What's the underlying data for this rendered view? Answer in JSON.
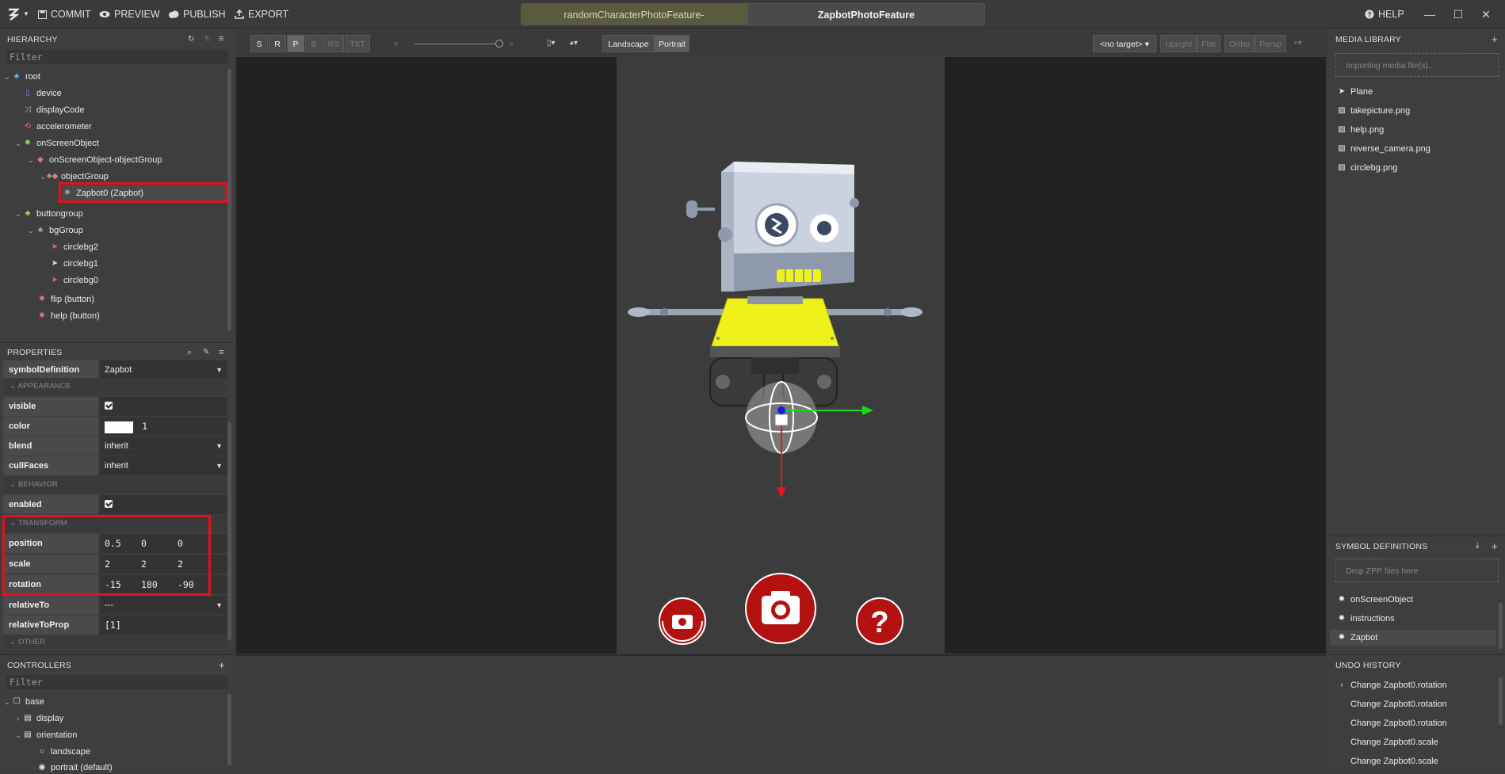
{
  "topbar": {
    "commit": "COMMIT",
    "preview": "PREVIEW",
    "publish": "PUBLISH",
    "export": "EXPORT",
    "tab_a": "randomCharacterPhotoFeature-",
    "tab_b": "ZapbotPhotoFeature",
    "help": "HELP"
  },
  "hierarchy": {
    "title": "HIERARCHY",
    "filter_placeholder": "Filter",
    "items": [
      {
        "label": "root"
      },
      {
        "label": "device"
      },
      {
        "label": "displayCode"
      },
      {
        "label": "accelerometer"
      },
      {
        "label": "onScreenObject"
      },
      {
        "label": "onScreenObject-objectGroup"
      },
      {
        "label": "objectGroup"
      },
      {
        "label": "Zapbot0 (Zapbot)"
      },
      {
        "label": "buttongroup"
      },
      {
        "label": "bgGroup"
      },
      {
        "label": "circlebg2"
      },
      {
        "label": "circlebg1"
      },
      {
        "label": "circlebg0"
      },
      {
        "label": "flip (button)"
      },
      {
        "label": "help (button)"
      }
    ]
  },
  "properties": {
    "title": "PROPERTIES",
    "symbolDefinition_label": "symbolDefinition",
    "symbolDefinition_value": "Zapbot",
    "section_appearance": "APPEARANCE",
    "visible_label": "visible",
    "color_label": "color",
    "color_alpha": "1",
    "blend_label": "blend",
    "blend_value": "inherit",
    "cullFaces_label": "cullFaces",
    "cullFaces_value": "inherit",
    "section_behavior": "BEHAVIOR",
    "enabled_label": "enabled",
    "section_transform": "TRANSFORM",
    "position_label": "position",
    "position": [
      "0.5",
      "0",
      "0"
    ],
    "scale_label": "scale",
    "scale": [
      "2",
      "2",
      "2"
    ],
    "rotation_label": "rotation",
    "rotation": [
      "-15",
      "180",
      "-90"
    ],
    "relativeTo_label": "relativeTo",
    "relativeTo_value": "---",
    "relativeToProp_label": "relativeToProp",
    "relativeToProp_value": "[1]",
    "section_other": "OTHER"
  },
  "controllers": {
    "title": "CONTROLLERS",
    "filter_placeholder": "Filter",
    "items": [
      {
        "label": "base"
      },
      {
        "label": "display"
      },
      {
        "label": "orientation"
      },
      {
        "label": "landscape"
      },
      {
        "label": "portrait (default)"
      }
    ]
  },
  "viewport_toolbar": {
    "s": "S",
    "r": "R",
    "p": "P",
    "b": "B",
    "rs": "RS",
    "txt": "TXT",
    "landscape": "Landscape",
    "portrait": "Portrait",
    "target": "<no target>",
    "upright": "Upright",
    "flat": "Flat",
    "ortho": "Ortho",
    "persp": "Persp"
  },
  "media_library": {
    "title": "MEDIA LIBRARY",
    "import_placeholder": "Importing media file(s)...",
    "items": [
      {
        "label": "Plane"
      },
      {
        "label": "takepicture.png"
      },
      {
        "label": "help.png"
      },
      {
        "label": "reverse_camera.png"
      },
      {
        "label": "circlebg.png"
      }
    ]
  },
  "symbol_definitions": {
    "title": "SYMBOL DEFINITIONS",
    "drop_placeholder": "Drop ZPP files here",
    "items": [
      {
        "label": "onScreenObject"
      },
      {
        "label": "instructions"
      },
      {
        "label": "Zapbot"
      }
    ]
  },
  "undo_history": {
    "title": "UNDO HISTORY",
    "items": [
      {
        "label": "Change Zapbot0.rotation"
      },
      {
        "label": "Change Zapbot0.rotation"
      },
      {
        "label": "Change Zapbot0.rotation"
      },
      {
        "label": "Change Zapbot0.scale"
      },
      {
        "label": "Change Zapbot0.scale"
      }
    ]
  },
  "colors": {
    "highlight": "#e4101f",
    "button_red": "#b41210",
    "robot_yellow": "#eef21a"
  }
}
